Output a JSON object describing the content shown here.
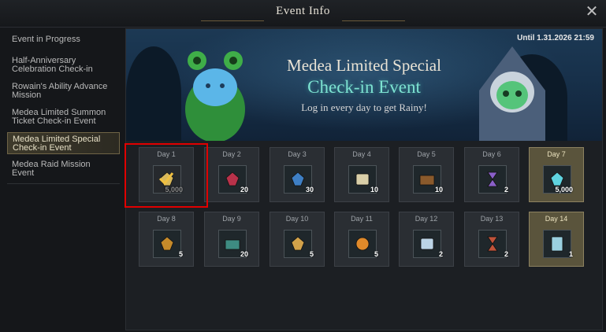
{
  "header": {
    "title": "Event Info"
  },
  "sidebar": {
    "items": [
      {
        "label_lines": [
          "Event in Progress"
        ]
      },
      {
        "label_lines": [
          "Half-Anniversary",
          "Celebration Check-in"
        ]
      },
      {
        "label_lines": [
          "Rowain's Ability Advance",
          "Mission"
        ]
      },
      {
        "label_lines": [
          "Medea Limited Summon",
          "Ticket Check-in Event"
        ]
      },
      {
        "label_lines": [
          "Medea Limited Special",
          "Check-in Event"
        ]
      },
      {
        "label_lines": [
          "Medea Raid Mission",
          "Event"
        ]
      }
    ],
    "active_index": 4
  },
  "banner": {
    "until": "Until 1.31.2026 21:59",
    "title_line1": "Medea Limited Special",
    "title_line2": "Check-in Event",
    "subtitle": "Log in every day to get Rainy!"
  },
  "days": [
    {
      "label": "Day 1",
      "qty": "5,000",
      "claimed": true,
      "item_icon": "crystal-icon",
      "color": "#d8b85a"
    },
    {
      "label": "Day 2",
      "qty": "20",
      "item_icon": "ruby-ore-icon",
      "color": "#b8324a"
    },
    {
      "label": "Day 3",
      "qty": "30",
      "item_icon": "sapphire-ore-icon",
      "color": "#3e7fc4"
    },
    {
      "label": "Day 4",
      "qty": "10",
      "item_icon": "scroll-icon",
      "color": "#d9cfa8"
    },
    {
      "label": "Day 5",
      "qty": "10",
      "item_icon": "treasure-chest-icon",
      "color": "#8a5a2c"
    },
    {
      "label": "Day 6",
      "qty": "2",
      "item_icon": "hourglass-icon",
      "color": "#8a5fc8"
    },
    {
      "label": "Day 7",
      "qty": "5,000",
      "special": true,
      "item_icon": "crystal-icon",
      "color": "#5fd3e0"
    },
    {
      "label": "Day 8",
      "qty": "5",
      "item_icon": "gold-ore-icon",
      "color": "#c68a2a"
    },
    {
      "label": "Day 9",
      "qty": "20",
      "item_icon": "teal-chest-icon",
      "color": "#3e8c82"
    },
    {
      "label": "Day 10",
      "qty": "5",
      "item_icon": "gold-beast-icon",
      "color": "#d2a24a"
    },
    {
      "label": "Day 11",
      "qty": "5",
      "item_icon": "fire-orb-icon",
      "color": "#e08a2a"
    },
    {
      "label": "Day 12",
      "qty": "2",
      "item_icon": "blue-scroll-icon",
      "color": "#bcd4e6"
    },
    {
      "label": "Day 13",
      "qty": "2",
      "item_icon": "red-hourglass-icon",
      "color": "#c0533a"
    },
    {
      "label": "Day 14",
      "qty": "1",
      "special": true,
      "item_icon": "summon-ticket-icon",
      "color": "#9ad0e0"
    }
  ]
}
